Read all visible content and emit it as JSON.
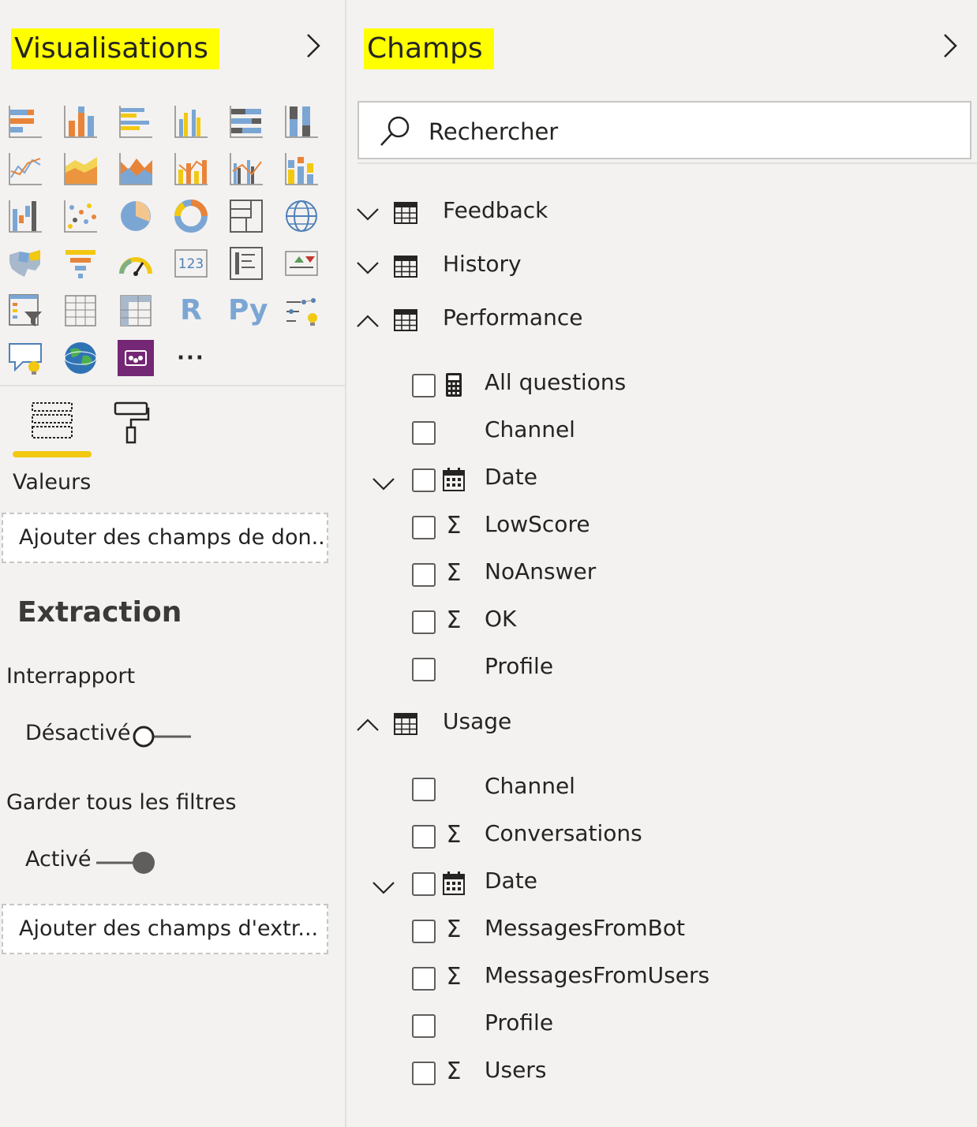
{
  "visualizations": {
    "title": "Visualisations",
    "icon_names": [
      "stacked-bar-chart-icon",
      "stacked-column-chart-icon",
      "clustered-bar-chart-icon",
      "clustered-column-chart-icon",
      "100-stacked-bar-chart-icon",
      "100-stacked-column-chart-icon",
      "line-chart-icon",
      "area-chart-icon",
      "stacked-area-chart-icon",
      "line-and-stacked-column-chart-icon",
      "line-and-clustered-column-chart-icon",
      "ribbon-chart-icon",
      "waterfall-chart-icon",
      "scatter-chart-icon",
      "pie-chart-icon",
      "donut-chart-icon",
      "treemap-icon",
      "map-icon",
      "filled-map-icon",
      "funnel-icon",
      "gauge-icon",
      "card-icon",
      "multi-row-card-icon",
      "kpi-icon",
      "slicer-icon",
      "table-icon",
      "matrix-icon",
      "r-script-visual-icon",
      "python-visual-icon",
      "key-influencers-icon",
      "qa-visual-icon",
      "arcgis-map-icon",
      "power-apps-icon",
      "more-visuals-icon"
    ],
    "r_label": "R",
    "py_label": "Py",
    "more_label": "···",
    "tabs": [
      "fields-tab-icon",
      "format-paint-roller-icon"
    ],
    "values_label": "Valeurs",
    "values_placeholder": "Ajouter des champs de don...",
    "drillthrough_heading": "Extraction",
    "cross_report_label": "Interrapport",
    "cross_report_state": "Désactivé",
    "cross_report_on": false,
    "keep_filters_label": "Garder tous les filtres",
    "keep_filters_state": "Activé",
    "keep_filters_on": true,
    "drillthrough_placeholder": "Ajouter des champs d'extr..."
  },
  "fields": {
    "title": "Champs",
    "search_placeholder": "Rechercher",
    "tables": [
      {
        "name": "Feedback",
        "expanded": false,
        "fields": []
      },
      {
        "name": "History",
        "expanded": false,
        "fields": []
      },
      {
        "name": "Performance",
        "expanded": true,
        "fields": [
          {
            "name": "All questions",
            "icon": "calculator",
            "expandable": false
          },
          {
            "name": "Channel",
            "icon": "none",
            "expandable": false
          },
          {
            "name": "Date",
            "icon": "calendar",
            "expandable": true
          },
          {
            "name": "LowScore",
            "icon": "sigma",
            "expandable": false
          },
          {
            "name": "NoAnswer",
            "icon": "sigma",
            "expandable": false
          },
          {
            "name": "OK",
            "icon": "sigma",
            "expandable": false
          },
          {
            "name": "Profile",
            "icon": "none",
            "expandable": false
          }
        ]
      },
      {
        "name": "Usage",
        "expanded": true,
        "fields": [
          {
            "name": "Channel",
            "icon": "none",
            "expandable": false
          },
          {
            "name": "Conversations",
            "icon": "sigma",
            "expandable": false
          },
          {
            "name": "Date",
            "icon": "calendar",
            "expandable": true
          },
          {
            "name": "MessagesFromBot",
            "icon": "sigma",
            "expandable": false
          },
          {
            "name": "MessagesFromUsers",
            "icon": "sigma",
            "expandable": false
          },
          {
            "name": "Profile",
            "icon": "none",
            "expandable": false
          },
          {
            "name": "Users",
            "icon": "sigma",
            "expandable": false
          }
        ]
      }
    ]
  },
  "colors": {
    "highlight": "#ffff00",
    "accent_yellow": "#f2c811",
    "blue": "#7ba6d4",
    "orange": "#e8843a",
    "gray": "#8a8886",
    "purple": "#742774"
  }
}
